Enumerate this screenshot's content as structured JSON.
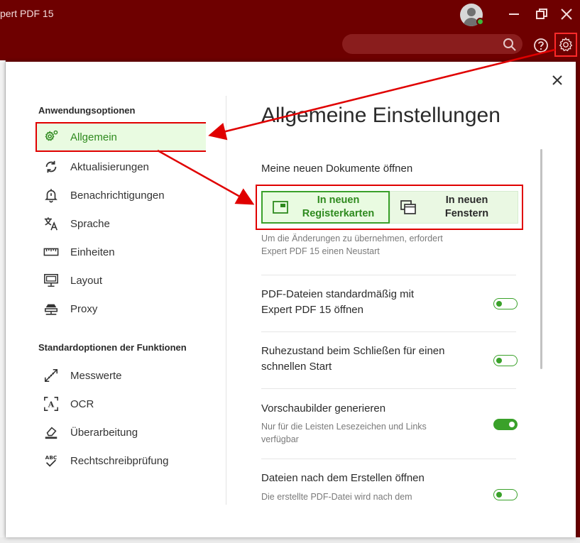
{
  "app": {
    "title": "pert PDF 15",
    "search_placeholder": ""
  },
  "dialog": {
    "sidebar": {
      "section1": "Anwendungsoptionen",
      "items1": [
        {
          "label": "Allgemein",
          "icon": "gear-icon",
          "active": true
        },
        {
          "label": "Aktualisierungen",
          "icon": "refresh-icon",
          "active": false
        },
        {
          "label": "Benachrichtigungen",
          "icon": "bell-icon",
          "active": false
        },
        {
          "label": "Sprache",
          "icon": "translate-icon",
          "active": false
        },
        {
          "label": "Einheiten",
          "icon": "ruler-icon",
          "active": false
        },
        {
          "label": "Layout",
          "icon": "layout-icon",
          "active": false
        },
        {
          "label": "Proxy",
          "icon": "proxy-icon",
          "active": false
        }
      ],
      "section2": "Standardoptionen der Funktionen",
      "items2": [
        {
          "label": "Messwerte",
          "icon": "measure-icon"
        },
        {
          "label": "OCR",
          "icon": "ocr-icon"
        },
        {
          "label": "Überarbeitung",
          "icon": "eraser-icon"
        },
        {
          "label": "Rechtschreibprüfung",
          "icon": "spellcheck-icon"
        }
      ]
    },
    "content": {
      "title": "Allgemeine Einstellungen",
      "open_docs_label": "Meine neuen Dokumente öffnen",
      "choice_tabs_line1": "In neuen",
      "choice_tabs_line2": "Registerkarten",
      "choice_windows_line1": "In neuen",
      "choice_windows_line2": "Fenstern",
      "selected_choice": "In neuen Registerkarten",
      "restart_note_line1": "Um die Änderungen zu übernehmen, erfordert",
      "restart_note_line2": "Expert PDF 15 einen Neustart",
      "settings": [
        {
          "line1": "PDF-Dateien standardmäßig mit",
          "line2": "Expert PDF 15 öffnen",
          "sub1": "",
          "sub2": "",
          "on": false
        },
        {
          "line1": "Ruhezustand beim Schließen für einen",
          "line2": "schnellen Start",
          "sub1": "",
          "sub2": "",
          "on": false
        },
        {
          "line1": "Vorschaubilder generieren",
          "line2": "",
          "sub1": "Nur für die Leisten Lesezeichen und Links",
          "sub2": "verfügbar",
          "on": true
        },
        {
          "line1": "Dateien nach dem Erstellen öffnen",
          "line2": "",
          "sub1": "Die erstellte PDF-Datei wird nach dem",
          "sub2": "",
          "on": false
        }
      ]
    }
  },
  "colors": {
    "titlebar": "#6e0000",
    "accent_green": "#3aa12a",
    "highlight_red": "#e00000"
  }
}
